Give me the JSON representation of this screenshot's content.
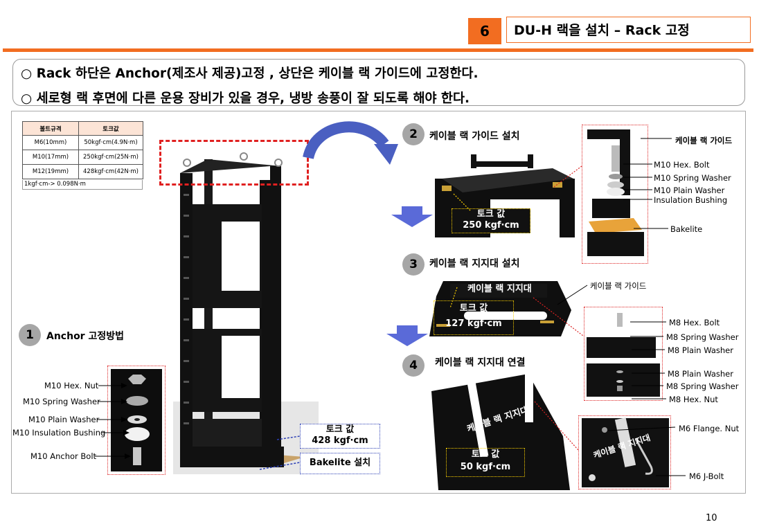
{
  "header": {
    "section_number": "6",
    "section_title": "DU-H 랙을 설치 – Rack 고정"
  },
  "notes": [
    "○ Rack 하단은 Anchor(제조사 제공)고정 , 상단은 케이블 랙 가이드에 고정한다.",
    "○ 세로형 랙 후면에 다른 운용 장비가 있을 경우, 냉방 송풍이 잘 되도록 해야 한다."
  ],
  "torque_table": {
    "headers": [
      "볼트규격",
      "토크값"
    ],
    "rows": [
      [
        "M6(10mm)",
        "50kgf·cm(4.9N·m)"
      ],
      [
        "M10(17mm)",
        "250kgf·cm(25N·m)"
      ],
      [
        "M12(19mm)",
        "428kgf·cm(42N·m)"
      ]
    ],
    "note": "1kgf·cm-> 0.098N·m"
  },
  "step1": {
    "number": "1",
    "title": "Anchor 고정방법",
    "parts": [
      "M10 Hex. Nut",
      "M10 Spring Washer",
      "M10 Plain Washer",
      "M10 Insulation Bushing",
      "M10 Anchor Bolt"
    ],
    "torque_line1": "토크 값",
    "torque_line2": "428 kgf·cm",
    "bakelite_label": "Bakelite 설치"
  },
  "step2": {
    "number": "2",
    "title": "케이블 랙 가이드 설치",
    "torque_line1": "토크 값",
    "torque_line2": "250 kgf·cm",
    "guide_label": "케이블 랙 가이드",
    "parts": [
      "M10 Hex. Bolt",
      "M10 Spring Washer",
      "M10 Plain Washer",
      "Insulation Bushing",
      "Bakelite"
    ]
  },
  "step3": {
    "number": "3",
    "title": "케이블 랙 지지대 설치",
    "support_label": "케이블 랙 지지대",
    "torque_line1": "토크 값",
    "torque_line2": "127 kgf·cm",
    "guide_label": "케이블 랙 가이드",
    "parts": [
      "M8 Hex. Bolt",
      "M8 Spring Washer",
      "M8 Plain Washer",
      "M8 Plain Washer",
      "M8 Spring Washer",
      "M8 Hex. Nut"
    ]
  },
  "step4": {
    "number": "4",
    "title": "케이블 랙 지지대 연결",
    "support_label": "케이블 랙 지지대",
    "torque_line1": "토크 값",
    "torque_line2": "50 kgf·cm",
    "detail_support_label": "케이블 랙 지지대",
    "parts": [
      "M6 Flange. Nut",
      "M6 J-Bolt"
    ]
  },
  "page_number": "10",
  "colors": {
    "accent": "#f26d21",
    "step_circle": "#a6a6a6",
    "arrow_blue": "#4a5fc1"
  }
}
